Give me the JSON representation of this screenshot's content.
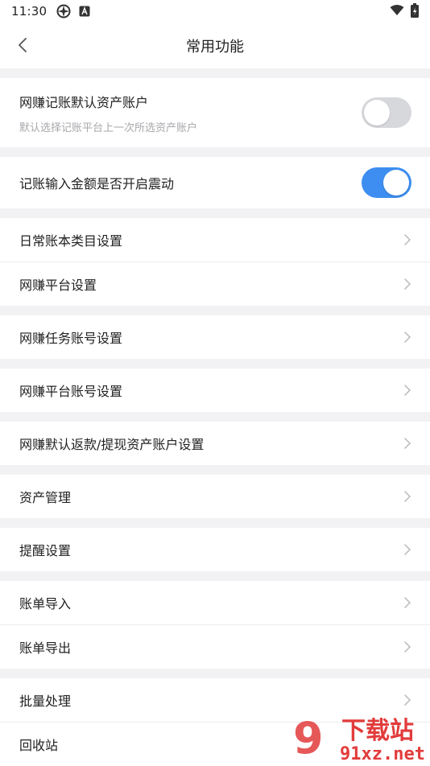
{
  "status_bar": {
    "time": "11:30"
  },
  "header": {
    "title": "常用功能"
  },
  "toggles": [
    {
      "label": "网赚记账默认资产账户",
      "sub": "默认选择记账平台上一次所选资产账户",
      "state": "off"
    },
    {
      "label": "记账输入金额是否开启震动",
      "state": "on"
    }
  ],
  "menu": {
    "daily_category": "日常账本类目设置",
    "platform_settings": "网赚平台设置",
    "task_account": "网赚任务账号设置",
    "platform_account": "网赚平台账号设置",
    "refund_account": "网赚默认返款/提现资产账户设置",
    "asset_management": "资产管理",
    "reminder": "提醒设置",
    "import": "账单导入",
    "export": "账单导出",
    "batch": "批量处理",
    "recycle": "回收站"
  },
  "watermark": {
    "brand": "下载站",
    "domain": "91xz.net",
    "mark": "9"
  },
  "colors": {
    "accent": "#3d8ef0",
    "watermark": "#e23b3b"
  }
}
